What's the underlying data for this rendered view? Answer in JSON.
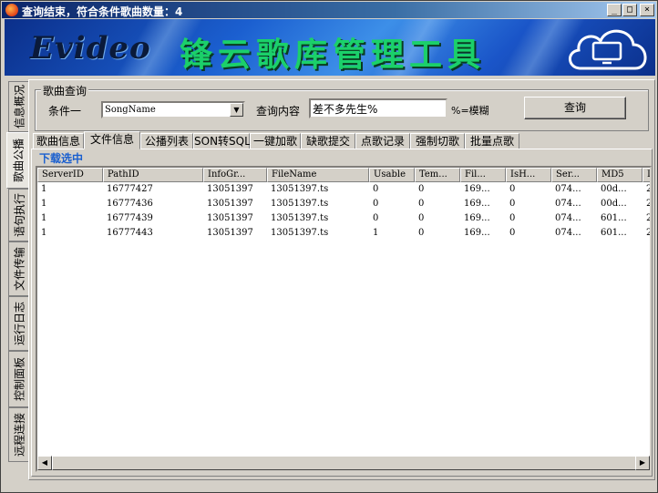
{
  "window": {
    "title": "查询结束，符合条件歌曲数量：4",
    "min_btn": "_",
    "max_btn": "□",
    "close_btn": "×"
  },
  "banner": {
    "logo": "Evideo",
    "title": "锋云歌库管理工具"
  },
  "side_tabs": [
    "信息概况",
    "歌曲公播",
    "语句执行",
    "文件传输",
    "运行日志",
    "控制面板",
    "远程连接"
  ],
  "search": {
    "group_title": "歌曲查询",
    "condition_label": "条件一",
    "condition_value": "SongName",
    "content_label": "查询内容",
    "content_value": "差不多先生%",
    "fuzzy_hint": "%=模糊",
    "query_button": "查询"
  },
  "tabs": [
    "歌曲信息",
    "文件信息",
    "公播列表",
    "SON转SQL",
    "一键加歌",
    "缺歌提交",
    "点歌记录",
    "强制切歌",
    "批量点歌"
  ],
  "active_tab": "文件信息",
  "download_label": "下载选中",
  "table": {
    "columns": [
      "ServerID",
      "PathID",
      "InfoGr...",
      "FileName",
      "Usable",
      "Tem...",
      "Fil...",
      "IsH...",
      "Ser...",
      "MD5",
      "I:"
    ],
    "rows": [
      [
        "1",
        "16777427",
        "13051397",
        "13051397.ts",
        "0",
        "0",
        "169...",
        "0",
        "074...",
        "00d...",
        "2("
      ],
      [
        "1",
        "16777436",
        "13051397",
        "13051397.ts",
        "0",
        "0",
        "169...",
        "0",
        "074...",
        "00d...",
        "2("
      ],
      [
        "1",
        "16777439",
        "13051397",
        "13051397.ts",
        "0",
        "0",
        "169...",
        "0",
        "074...",
        "601...",
        "2("
      ],
      [
        "1",
        "16777443",
        "13051397",
        "13051397.ts",
        "1",
        "0",
        "169...",
        "0",
        "074...",
        "601...",
        "2("
      ]
    ]
  }
}
